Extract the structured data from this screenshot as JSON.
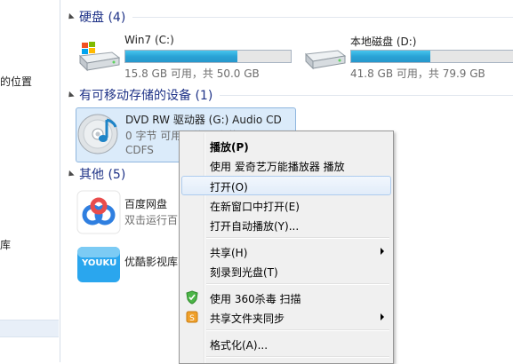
{
  "sidebar": {
    "items": [
      {
        "label": "的位置"
      },
      {
        "label": "库"
      }
    ]
  },
  "sections": {
    "hdd": {
      "title": "硬盘 (4)"
    },
    "removable": {
      "title": "有可移动存储的设备 (1)"
    },
    "other": {
      "title": "其他 (5)"
    }
  },
  "drives": [
    {
      "name": "Win7 (C:)",
      "usage": "15.8 GB 可用，共 50.0 GB",
      "used_fraction": 0.68
    },
    {
      "name": "本地磁盘 (D:)",
      "usage": "41.8 GB 可用，共 79.9 GB",
      "used_fraction": 0.48
    }
  ],
  "dvd": {
    "name": "DVD RW 驱动器 (G:) Audio CD",
    "line2": "0 字节 可用，共 0 字节",
    "fs": "CDFS"
  },
  "other_items": [
    {
      "name": "百度网盘",
      "sub": "双击运行百"
    },
    {
      "name": "优酷影视库",
      "logo_text": "YOUKU"
    }
  ],
  "context_menu": {
    "items": [
      {
        "label": "播放(P)"
      },
      {
        "label": "使用 爱奇艺万能播放器 播放"
      },
      {
        "label": "打开(O)"
      },
      {
        "label": "在新窗口中打开(E)"
      },
      {
        "label": "打开自动播放(Y)..."
      },
      {
        "label": "共享(H)"
      },
      {
        "label": "刻录到光盘(T)"
      },
      {
        "label": "使用 360杀毒 扫描"
      },
      {
        "label": "共享文件夹同步"
      },
      {
        "label": "格式化(A)..."
      }
    ]
  },
  "colors": {
    "section_title": "#1e3287",
    "bar_fill": "#2aa3d6",
    "menu_hover": "#e1ecf9"
  }
}
